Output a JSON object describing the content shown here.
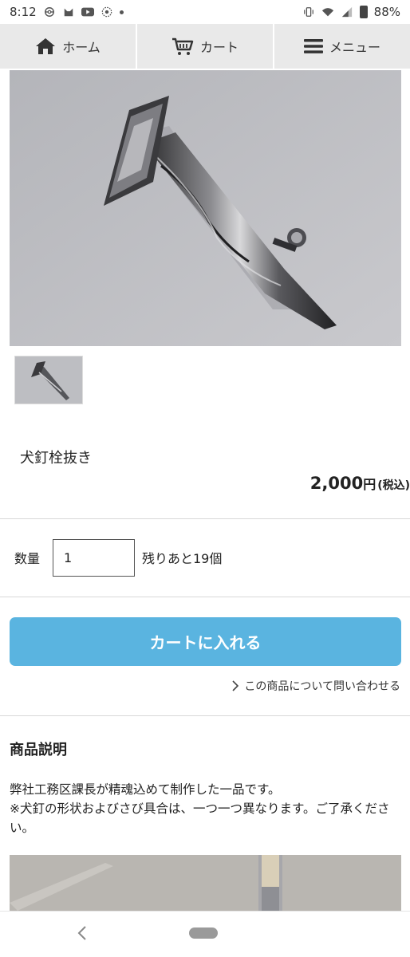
{
  "status_bar": {
    "time": "8:12",
    "battery": "88%"
  },
  "nav": {
    "items": [
      {
        "label": "ホーム",
        "icon": "home-icon"
      },
      {
        "label": "カート",
        "icon": "cart-icon"
      },
      {
        "label": "メニュー",
        "icon": "menu-icon"
      }
    ]
  },
  "product": {
    "title": "犬釘栓抜き",
    "price_amount": "2,000",
    "price_yen": "円",
    "price_tax": "(税込)"
  },
  "quantity": {
    "label": "数量",
    "value": "1",
    "stock": "残りあと19個"
  },
  "cart_button": {
    "label": "カートに入れる"
  },
  "inquiry": {
    "label": "この商品について問い合わせる"
  },
  "description": {
    "heading": "商品説明",
    "line1": "弊社工務区課長が精魂込めて制作した一品です。",
    "line2": "※犬釘の形状およびさび具合は、一つ一つ異なります。ご了承ください。"
  },
  "colors": {
    "accent": "#5ab4e0",
    "nav_bg": "#e9e9e9"
  }
}
